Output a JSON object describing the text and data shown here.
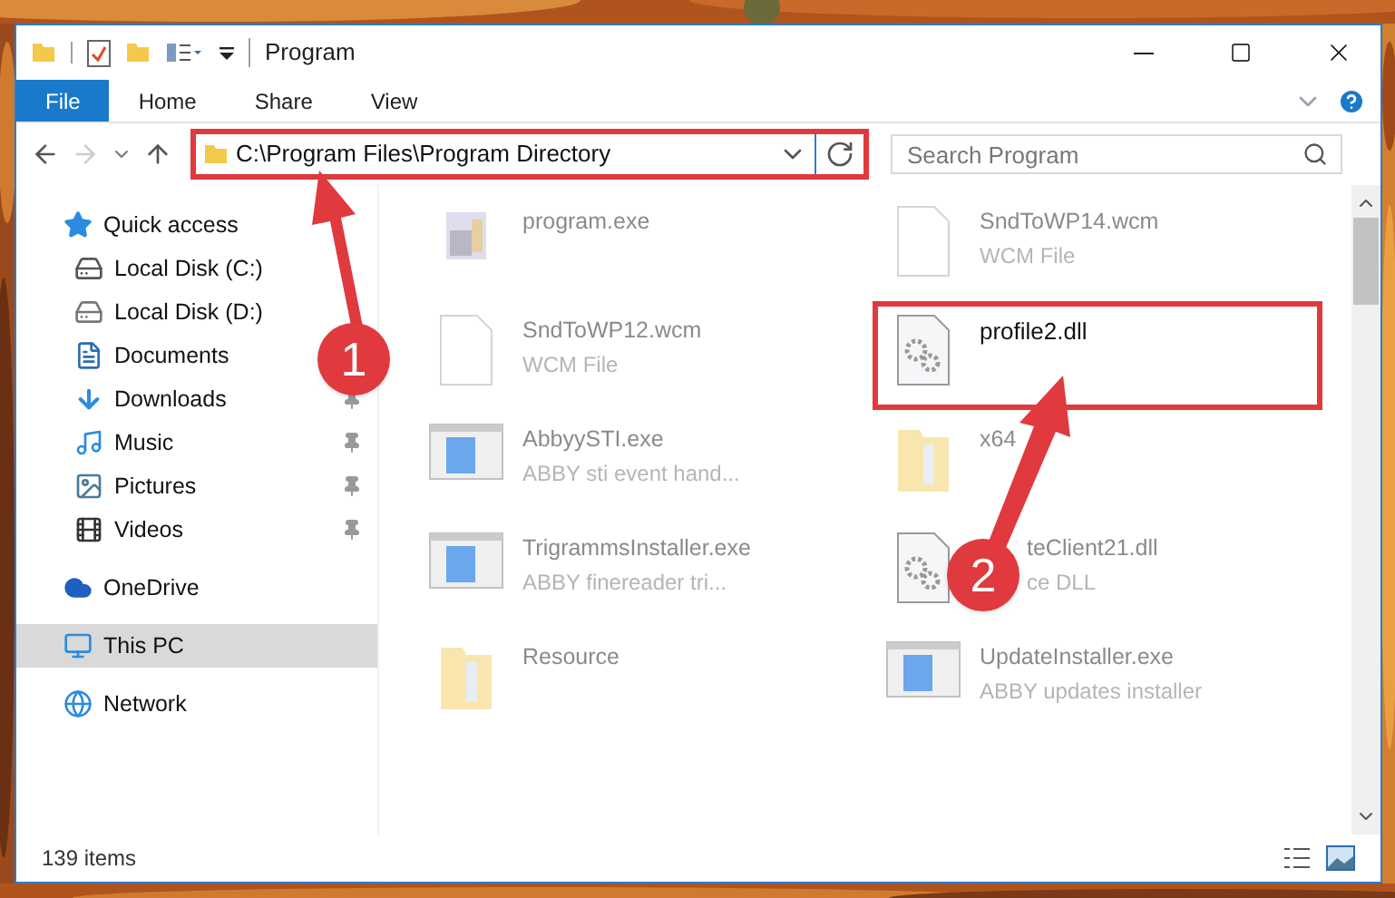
{
  "window": {
    "title": "Program"
  },
  "ribbon_tabs": [
    {
      "label": "File",
      "selected": true
    },
    {
      "label": "Home",
      "selected": false
    },
    {
      "label": "Share",
      "selected": false
    },
    {
      "label": "View",
      "selected": false
    }
  ],
  "address": {
    "path": "C:\\Program Files\\Program Directory",
    "highlighted": true
  },
  "search": {
    "placeholder": "Search Program"
  },
  "sidebar": {
    "items": [
      {
        "label": "Quick access",
        "kind": "star",
        "selected": false,
        "children": [
          {
            "label": "Local Disk (C:)",
            "kind": "drive-c",
            "pinned": false,
            "selected": false
          },
          {
            "label": "Local Disk (D:)",
            "kind": "drive",
            "pinned": false,
            "selected": false
          },
          {
            "label": "Documents",
            "kind": "documents",
            "pinned": false,
            "selected": false
          },
          {
            "label": "Downloads",
            "kind": "downloads",
            "pinned": true,
            "selected": false
          },
          {
            "label": "Music",
            "kind": "music",
            "pinned": true,
            "selected": false
          },
          {
            "label": "Pictures",
            "kind": "pictures",
            "pinned": true,
            "selected": false
          },
          {
            "label": "Videos",
            "kind": "videos",
            "pinned": true,
            "selected": false
          }
        ]
      },
      {
        "label": "OneDrive",
        "kind": "cloud",
        "selected": false
      },
      {
        "label": "This PC",
        "kind": "pc",
        "selected": true
      },
      {
        "label": "Network",
        "kind": "network",
        "selected": false
      }
    ]
  },
  "files": [
    {
      "name": "program.exe",
      "kind": "installer",
      "highlighted": false
    },
    {
      "name": "SndToWP14.wcm",
      "type": "WCM File",
      "kind": "blank",
      "highlighted": false
    },
    {
      "name": "SndToWP12.wcm",
      "type": "WCM File",
      "kind": "blank",
      "highlighted": false
    },
    {
      "name": "profile2.dll",
      "kind": "dll",
      "highlighted": true
    },
    {
      "name": "AbbyySTI.exe",
      "type": "ABBY sti event hand...",
      "kind": "app",
      "highlighted": false
    },
    {
      "name": "x64",
      "kind": "folder",
      "highlighted": false
    },
    {
      "name": "TrigrammsInstaller.exe",
      "type": "ABBY finereader tri...",
      "kind": "app",
      "highlighted": false
    },
    {
      "name": "teClient21.dll",
      "type": "ce DLL",
      "kind": "dll",
      "highlighted": false,
      "badge": "2"
    },
    {
      "name": "Resource",
      "kind": "folder",
      "highlighted": false
    },
    {
      "name": "UpdateInstaller.exe",
      "type": "ABBY updates installer",
      "kind": "app",
      "highlighted": false
    }
  ],
  "annotations": [
    {
      "label": "1"
    }
  ],
  "status_bar": {
    "item_count": "139 items"
  }
}
